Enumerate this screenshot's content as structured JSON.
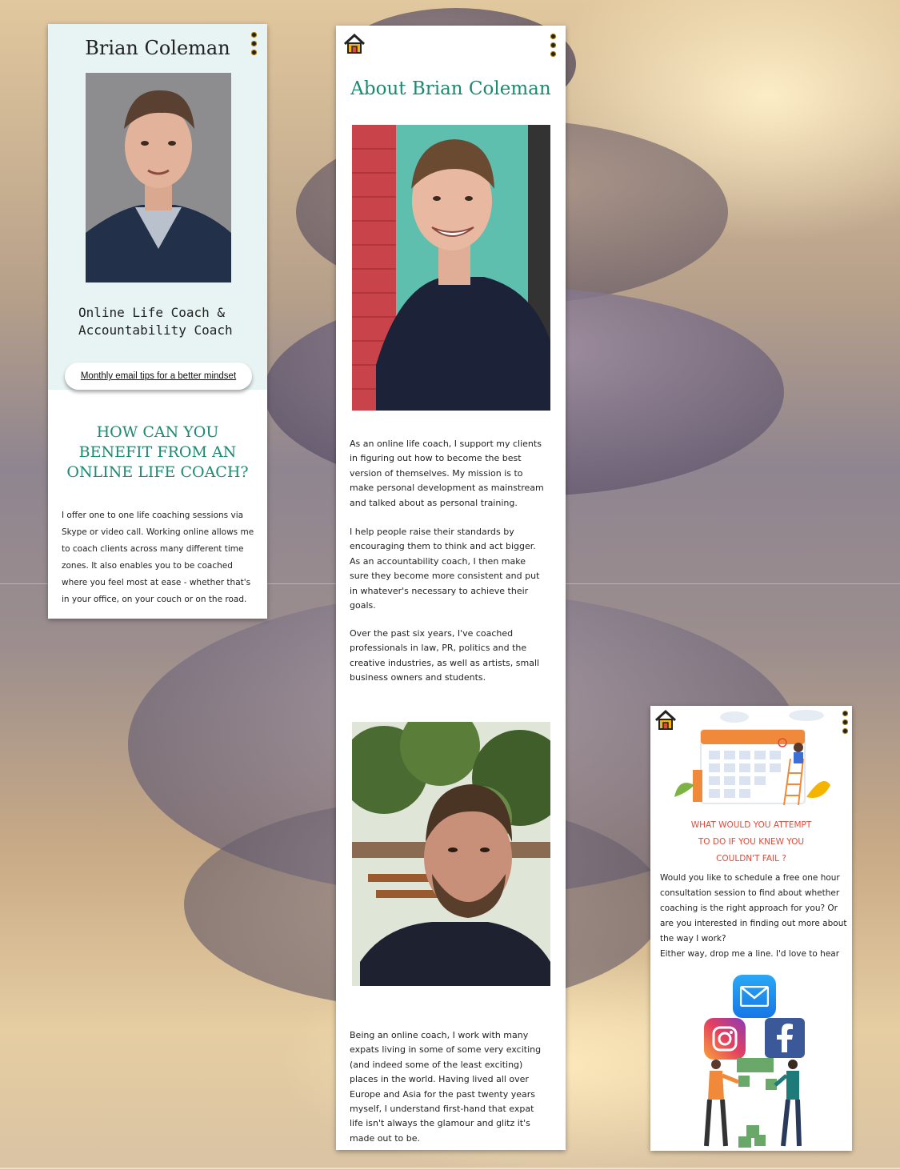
{
  "colors": {
    "accent_green": "#1a8a70",
    "question_red": "#e04a3a",
    "header_bg": "#e8f4f3"
  },
  "profile_panel": {
    "name": "Brian Coleman",
    "tagline_line1": "Online Life Coach &",
    "tagline_line2": "Accountability Coach",
    "newsletter_button": "Monthly email tips for a better mindset",
    "heading_lines": [
      "HOW CAN YOU",
      "BENEFIT FROM AN",
      "ONLINE LIFE COACH?"
    ],
    "body_lines": [
      "I offer one to one life coaching sessions via",
      "Skype or video call. Working online allows me",
      "to coach clients across many different time",
      "zones. It also enables you to be coached",
      "where you feel most at ease - whether that's",
      "in your office, on your couch or on the road."
    ]
  },
  "about_panel": {
    "title": "About Brian Coleman",
    "paragraph1": [
      "As an online life coach, I support my clients",
      "in figuring out how to become the best",
      "version of themselves. My mission is to",
      "make personal development as mainstream",
      "and talked about as personal training."
    ],
    "paragraph2": [
      "I help people raise their standards by",
      "encouraging them to think and act bigger.",
      "As an accountability coach, I then make",
      "sure they become more consistent and put",
      "in whatever's necessary to achieve their",
      "goals."
    ],
    "paragraph3": [
      "Over the past six years, I've coached",
      "professionals in law, PR, politics and the",
      "creative industries, as well as artists, small",
      "business owners and students."
    ],
    "paragraph4": [
      "Being an online coach, I work with many",
      "expats living in some of some very exciting",
      "(and indeed some of the least exciting)",
      "places in the world. Having lived all over",
      "Europe and Asia for the past twenty years",
      "myself, I understand first-hand that expat",
      "life isn't always the glamour and glitz it's",
      "made out to be."
    ]
  },
  "contact_panel": {
    "question_lines": [
      "WHAT WOULD YOU ATTEMPT",
      "TO DO IF YOU KNEW YOU",
      "COULDN'T FAIL ?"
    ],
    "body_lines": [
      "Would you like to schedule a free one hour",
      "consultation session to find about whether",
      "coaching is the right approach for you? Or",
      "are you interested in finding out more about",
      "the way I work?",
      "Either way, drop me a line. I'd love to hear"
    ],
    "icons": [
      "mail-icon",
      "instagram-icon",
      "facebook-icon"
    ]
  }
}
